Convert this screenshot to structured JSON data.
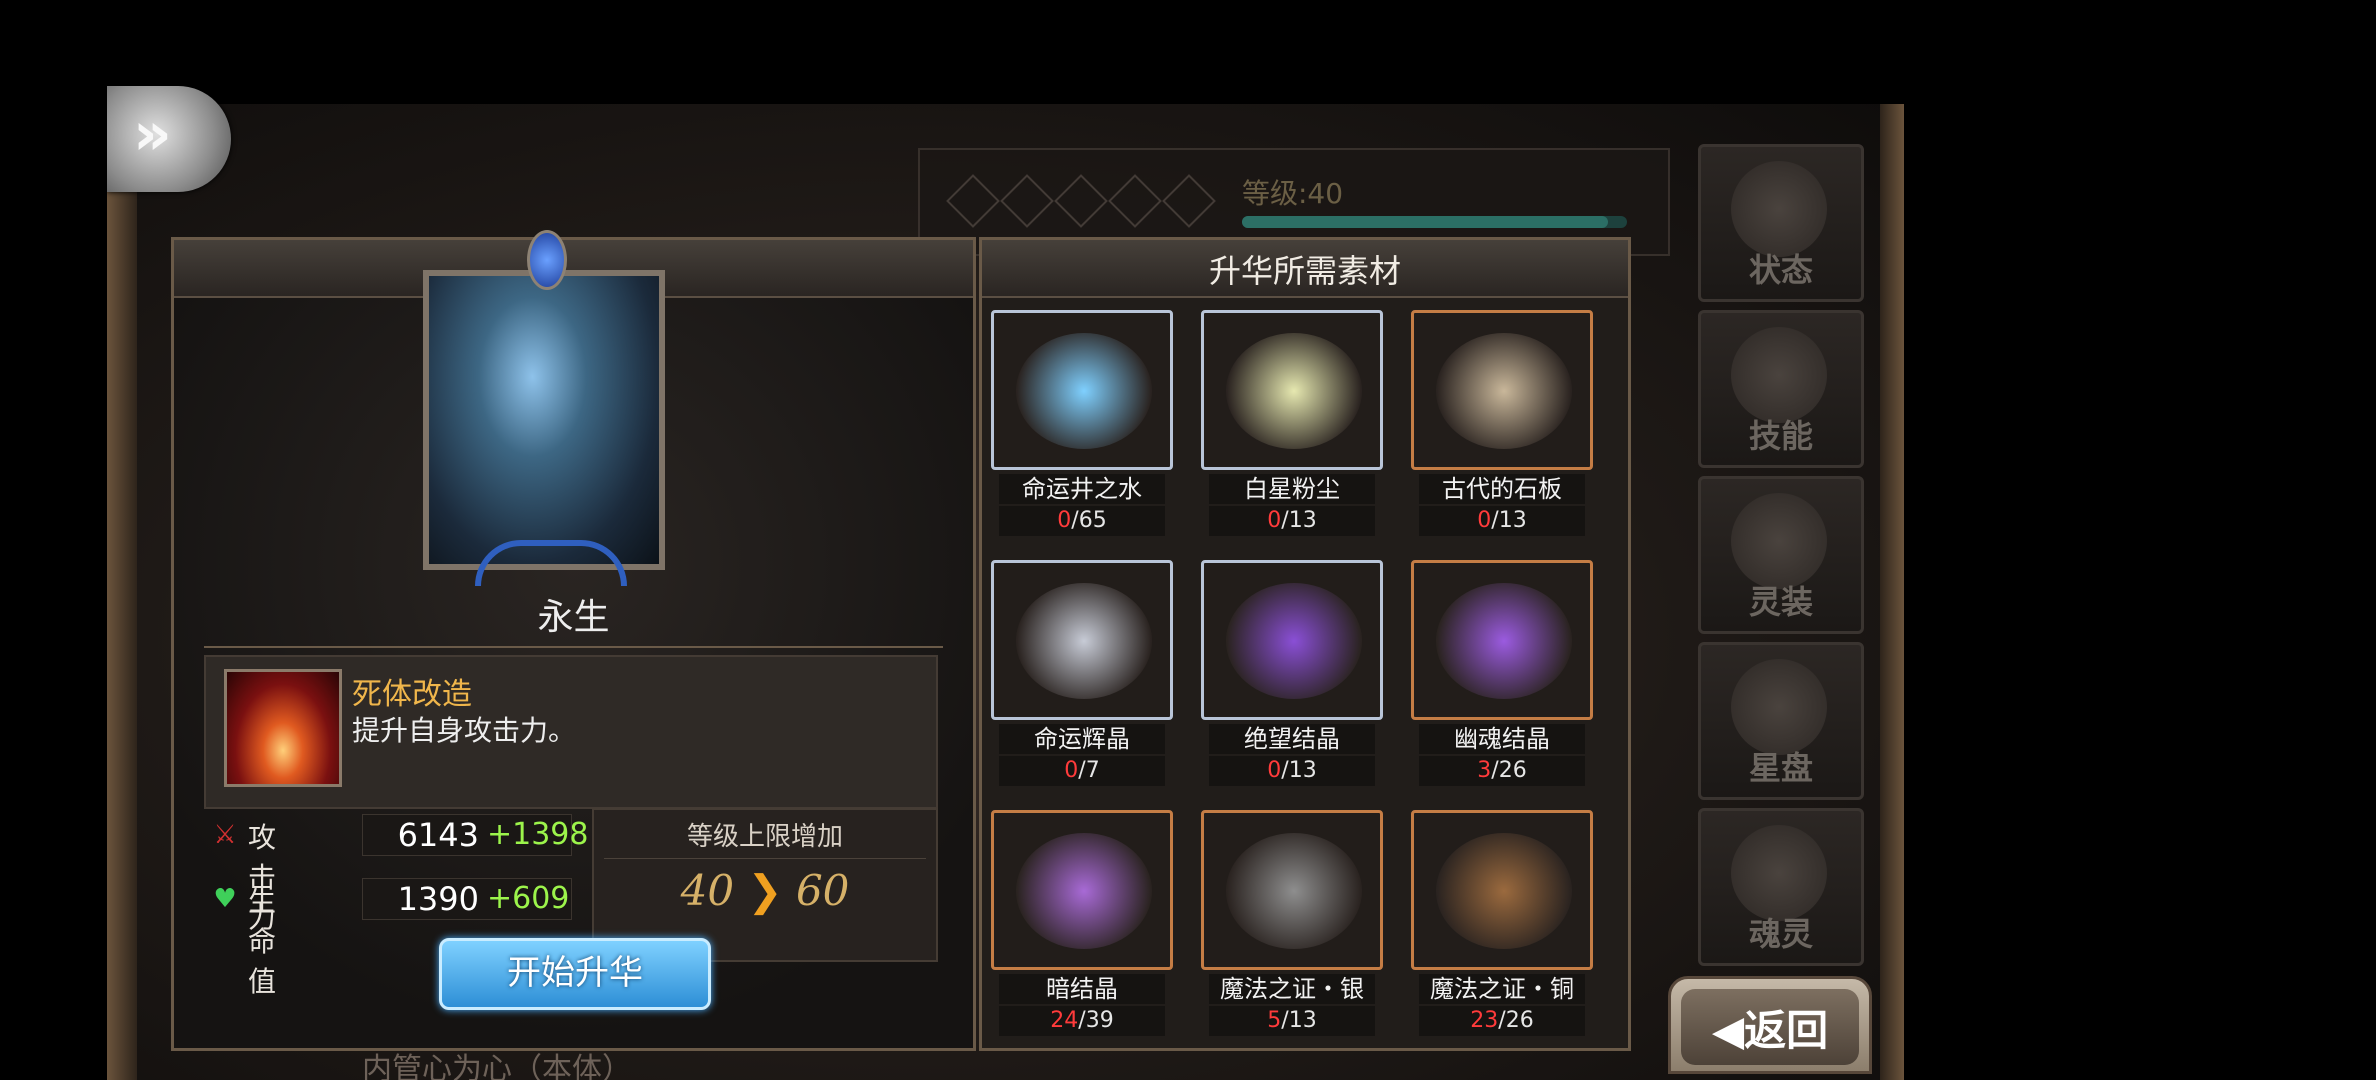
{
  "header": {
    "menu_button_icon": "chevron-right-icon"
  },
  "background": {
    "level_text": "等级:40",
    "level_progress": 0.95
  },
  "side_tabs": [
    {
      "label": "状态",
      "icon": "flower-icon"
    },
    {
      "label": "技能",
      "icon": "sword-icon"
    },
    {
      "label": "灵装",
      "icon": "helmet-icon"
    },
    {
      "label": "星盘",
      "icon": "orb-icon"
    },
    {
      "label": "魂灵",
      "icon": "book-icon"
    }
  ],
  "card": {
    "name": "永生"
  },
  "skill": {
    "name": "死体改造",
    "description": "提升自身攻击力。"
  },
  "stats": [
    {
      "label": "攻击力",
      "base": "6143",
      "bonus": "+1398",
      "icon": "crossed-swords-icon"
    },
    {
      "label": "生命值",
      "base": "1390",
      "bonus": "+609",
      "icon": "heart-icon"
    }
  ],
  "limit": {
    "title": "等级上限增加",
    "from": "40",
    "to": "60"
  },
  "start_button": "开始升华",
  "materials_title": "升华所需素材",
  "materials": [
    {
      "name": "命运井之水",
      "have": "0",
      "need": "/65",
      "frame": "silver",
      "color": "#7fd0ff"
    },
    {
      "name": "白星粉尘",
      "have": "0",
      "need": "/13",
      "frame": "silver",
      "color": "#e6e8b0"
    },
    {
      "name": "古代的石板",
      "have": "0",
      "need": "/13",
      "frame": "bronze",
      "color": "#c9b79a"
    },
    {
      "name": "命运辉晶",
      "have": "0",
      "need": "/7",
      "frame": "silver",
      "color": "#c7cbd6"
    },
    {
      "name": "绝望结晶",
      "have": "0",
      "need": "/13",
      "frame": "silver",
      "color": "#8a4fd6"
    },
    {
      "name": "幽魂结晶",
      "have": "3",
      "need": "/26",
      "frame": "bronze",
      "color": "#9b5be0"
    },
    {
      "name": "暗结晶",
      "have": "24",
      "need": "/39",
      "frame": "bronze",
      "color": "#a86ad6"
    },
    {
      "name": "魔法之证・银",
      "have": "5",
      "need": "/13",
      "frame": "bronze",
      "color": "#8e8e8e"
    },
    {
      "name": "魔法之证・铜",
      "have": "23",
      "need": "/26",
      "frame": "bronze",
      "color": "#9b6a3e"
    }
  ],
  "back_button": "返回",
  "bottom_text": "内管心为心（本体）"
}
